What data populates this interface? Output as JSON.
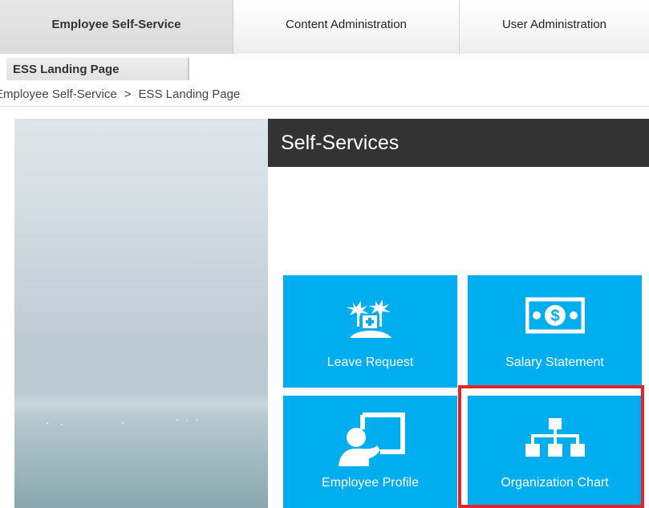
{
  "top_tabs": [
    {
      "label": "Employee Self-Service",
      "active": true
    },
    {
      "label": "Content Administration",
      "active": false
    },
    {
      "label": "User Administration",
      "active": false
    }
  ],
  "subnav": {
    "label": "ESS Landing Page"
  },
  "breadcrumb": {
    "items": [
      "Employee Self-Service",
      "ESS Landing Page"
    ],
    "separator": ">"
  },
  "panel": {
    "title": "Self-Services"
  },
  "tiles": [
    {
      "label": "Leave Request",
      "icon": "palm-trees-plus-icon"
    },
    {
      "label": "Salary Statement",
      "icon": "money-bill-icon"
    },
    {
      "label": "Employee Profile",
      "icon": "person-presentation-icon"
    },
    {
      "label": "Organization Chart",
      "icon": "org-chart-icon"
    }
  ],
  "colors": {
    "tile": "#00aeef",
    "header": "#333333",
    "highlight": "#e3242b"
  }
}
